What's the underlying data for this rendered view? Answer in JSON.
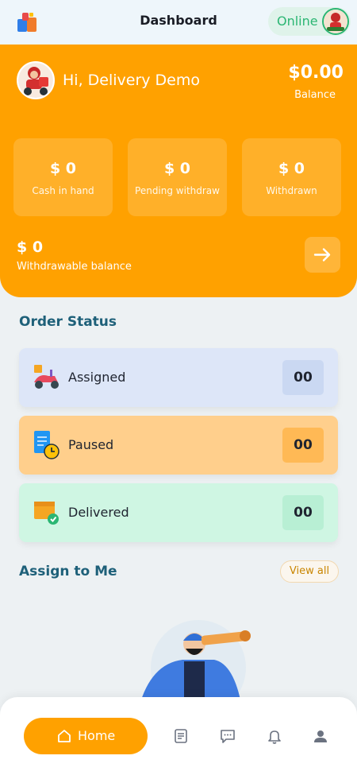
{
  "header": {
    "title": "Dashboard",
    "status_label": "Online"
  },
  "hero": {
    "greeting": "Hi, Delivery Demo",
    "balance_amount": "$0.00",
    "balance_label": "Balance",
    "stats": [
      {
        "value": "$ 0",
        "label": "Cash in hand"
      },
      {
        "value": "$ 0",
        "label": "Pending withdraw"
      },
      {
        "value": "$ 0",
        "label": "Withdrawn"
      }
    ],
    "withdrawable_amount": "$ 0",
    "withdrawable_label": "Withdrawable balance"
  },
  "order_status": {
    "title": "Order Status",
    "items": [
      {
        "label": "Assigned",
        "count": "00",
        "icon": "scooter-icon",
        "bg": "#dde6f8",
        "badge": "#cad8f2"
      },
      {
        "label": "Paused",
        "count": "00",
        "icon": "document-clock-icon",
        "bg": "#ffcf8c",
        "badge": "#ffb955"
      },
      {
        "label": "Delivered",
        "count": "00",
        "icon": "package-check-icon",
        "bg": "#cff6e3",
        "badge": "#b8efd4"
      }
    ]
  },
  "assign": {
    "title": "Assign to Me",
    "view_all": "View all"
  },
  "nav": {
    "home_label": "Home",
    "icons": [
      "orders-icon",
      "chat-icon",
      "bell-icon",
      "profile-icon"
    ]
  },
  "colors": {
    "accent": "#ffa100",
    "online": "#2bb673",
    "heading": "#1e6079"
  }
}
